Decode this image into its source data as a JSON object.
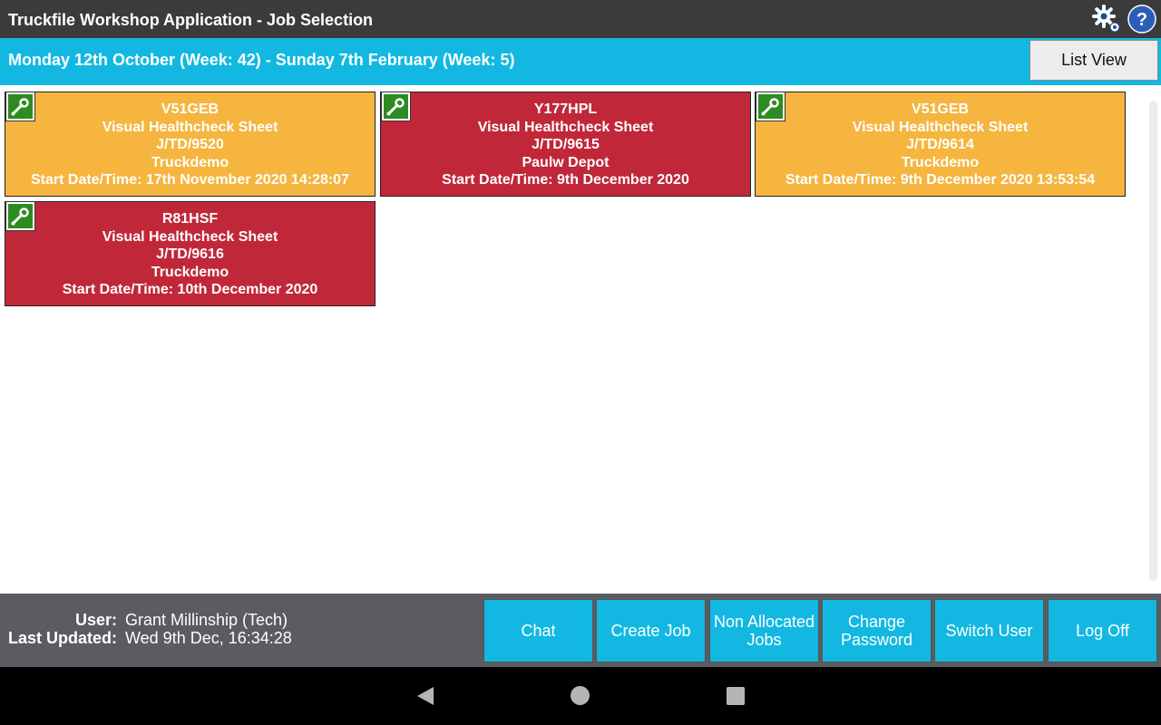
{
  "window": {
    "title": "Truckfile Workshop Application - Job Selection"
  },
  "header": {
    "date_range": "Monday 12th October (Week: 42) - Sunday 7th February (Week: 5)",
    "list_view_label": "List View",
    "settings_icon": "gears-icon",
    "help_icon": "help-icon"
  },
  "jobs": [
    {
      "reg": "V51GEB",
      "type": "Visual Healthcheck Sheet",
      "job_no": "J/TD/9520",
      "depot": "Truckdemo",
      "start": "Start Date/Time: 17th November 2020 14:28:07",
      "status_color": "#f5b53f"
    },
    {
      "reg": "Y177HPL",
      "type": "Visual Healthcheck Sheet",
      "job_no": "J/TD/9615",
      "depot": "Paulw Depot",
      "start": "Start Date/Time: 9th December 2020",
      "status_color": "#c0283a"
    },
    {
      "reg": "V51GEB",
      "type": "Visual Healthcheck Sheet",
      "job_no": "J/TD/9614",
      "depot": "Truckdemo",
      "start": "Start Date/Time: 9th December 2020 13:53:54",
      "status_color": "#f5b53f"
    },
    {
      "reg": "R81HSF",
      "type": "Visual Healthcheck Sheet",
      "job_no": "J/TD/9616",
      "depot": "Truckdemo",
      "start": "Start Date/Time: 10th December 2020",
      "status_color": "#c0283a"
    }
  ],
  "footer": {
    "user_label": "User:",
    "user_value": "Grant Millinship (Tech)",
    "updated_label": "Last Updated:",
    "updated_value": "Wed 9th Dec, 16:34:28",
    "buttons": [
      "Chat",
      "Create Job",
      "Non Allocated Jobs",
      "Change Password",
      "Switch User",
      "Log Off"
    ]
  },
  "navbar": {
    "icons": [
      "back-icon",
      "home-icon",
      "recent-apps-icon"
    ]
  },
  "colors": {
    "title_bar": "#3b3b3d",
    "accent": "#12b8e1",
    "footer": "#5b5b62",
    "amber": "#f5b53f",
    "red": "#c0283a",
    "wrench_green": "#2e8b22"
  }
}
